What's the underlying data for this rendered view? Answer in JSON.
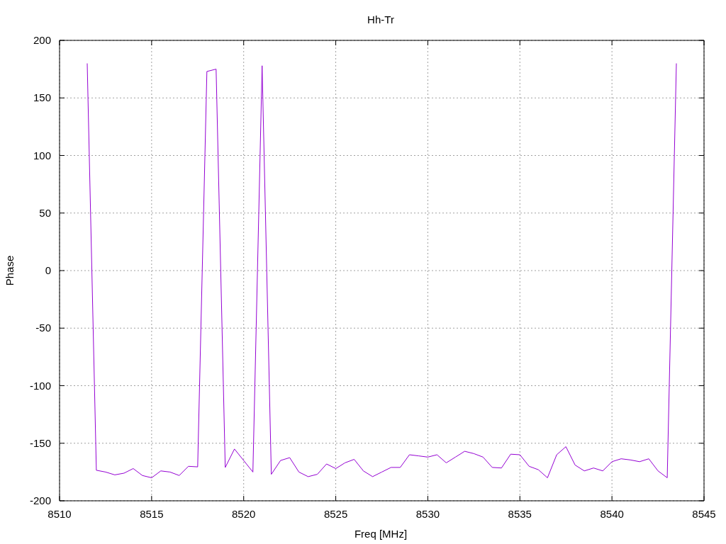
{
  "chart_data": {
    "type": "line",
    "grid": true,
    "title": "Hh-Tr",
    "xlabel": "Freq [MHz]",
    "ylabel": "Phase",
    "xlim": [
      8510,
      8545
    ],
    "ylim": [
      -200,
      200
    ],
    "xticks": [
      8510,
      8515,
      8520,
      8525,
      8530,
      8535,
      8540,
      8545
    ],
    "yticks": [
      -200,
      -150,
      -100,
      -50,
      0,
      50,
      100,
      150,
      200
    ],
    "x": [
      8511.5,
      8512,
      8512.5,
      8513,
      8513.5,
      8514,
      8514.5,
      8515,
      8515.5,
      8516,
      8516.5,
      8517,
      8517.5,
      8518,
      8518.5,
      8519,
      8519.5,
      8520,
      8520.5,
      8521,
      8521.5,
      8522,
      8522.5,
      8523,
      8523.5,
      8524,
      8524.5,
      8525,
      8525.5,
      8526,
      8526.5,
      8527,
      8527.5,
      8528,
      8528.5,
      8529,
      8529.5,
      8530,
      8530.5,
      8531,
      8531.5,
      8532,
      8532.5,
      8533,
      8533.5,
      8534,
      8534.5,
      8535,
      8535.5,
      8536,
      8536.5,
      8537,
      8537.5,
      8538,
      8538.5,
      8539,
      8539.5,
      8540,
      8540.5,
      8541,
      8541.5,
      8542,
      8542.5,
      8543,
      8543.5
    ],
    "series": [
      {
        "color": "#9400d3",
        "values": [
          180,
          -173.5,
          -175,
          -177.5,
          -176,
          -172,
          -178,
          -180,
          -174,
          -175,
          -178,
          -170,
          -170.5,
          173,
          175,
          -171,
          -155,
          -165,
          -175,
          178,
          -177,
          -165,
          -162.5,
          -175,
          -179,
          -177,
          -168,
          -172,
          -167,
          -164,
          -174,
          -179,
          -175,
          -171,
          -171,
          -160,
          -161,
          -162,
          -160,
          -167,
          -162,
          -157,
          -159,
          -162,
          -171,
          -171.5,
          -159.5,
          -160,
          -170,
          -173,
          -180,
          -160,
          -153,
          -169,
          -174,
          -171.5,
          -174,
          -166,
          -163.5,
          -164.5,
          -166,
          -163.5,
          -174,
          -180,
          180
        ]
      }
    ]
  }
}
